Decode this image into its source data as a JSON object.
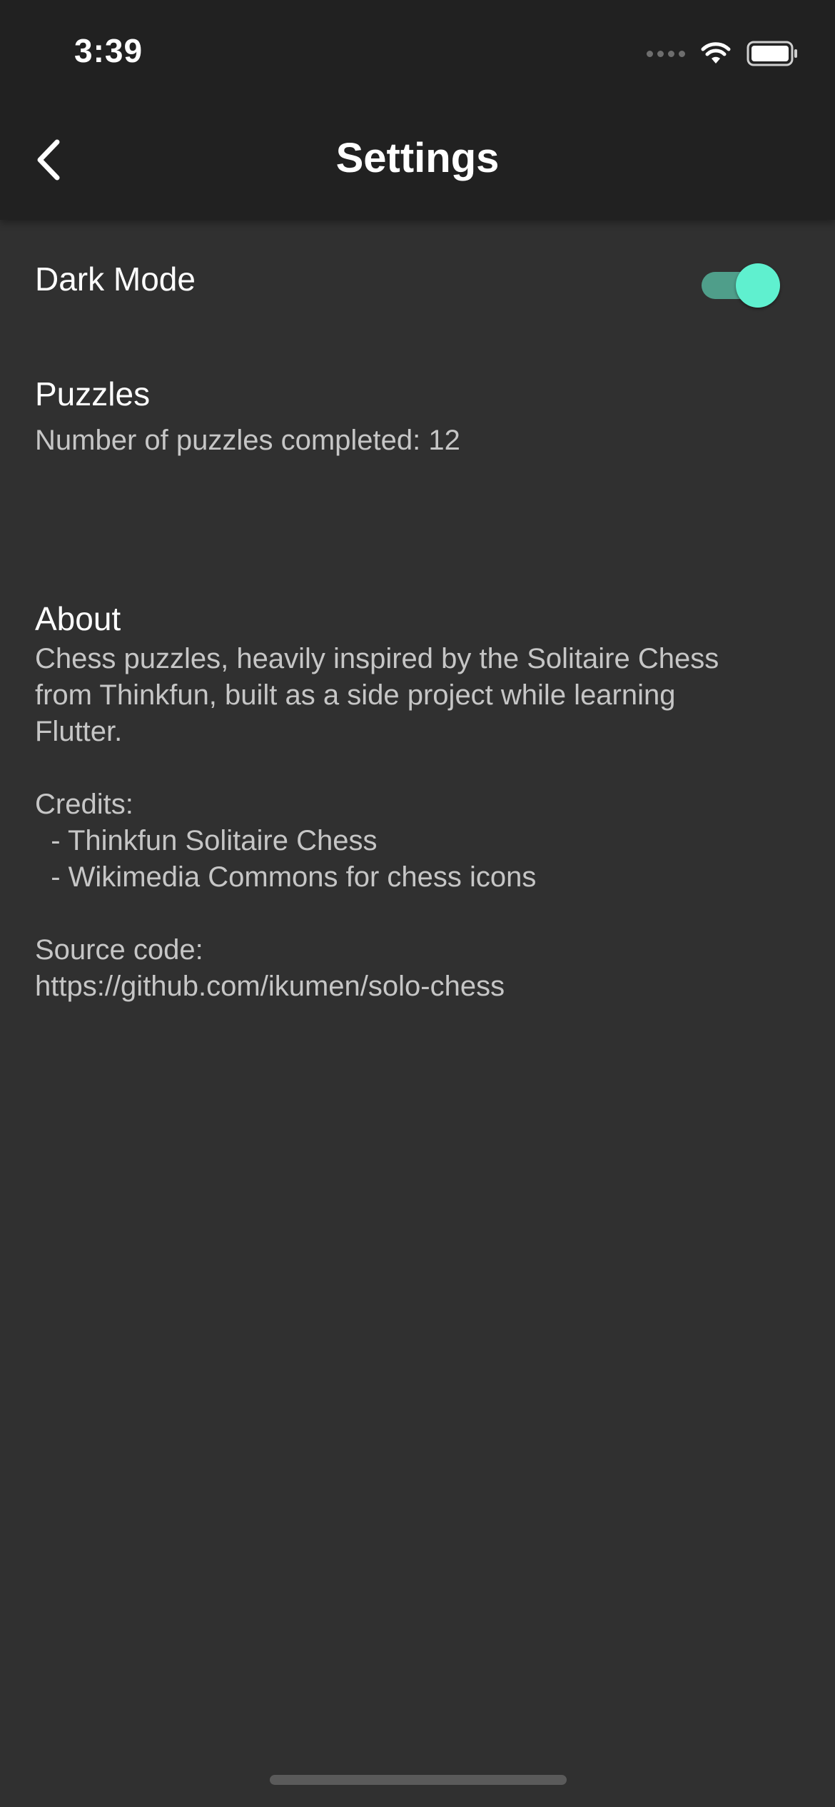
{
  "status_bar": {
    "time": "3:39"
  },
  "header": {
    "title": "Settings",
    "back_icon": "chevron-left-icon"
  },
  "settings": {
    "dark_mode": {
      "label": "Dark Mode",
      "enabled": true
    },
    "puzzles": {
      "title": "Puzzles",
      "completed_text": "Number of puzzles completed: 12"
    },
    "about": {
      "title": "About",
      "lines": [
        "Chess puzzles, heavily inspired by the Solitaire Chess",
        "from Thinkfun, built as a side project while learning",
        "Flutter.",
        "",
        "Credits:",
        "  - Thinkfun Solitaire Chess",
        "  - Wikimedia Commons for chess icons",
        "",
        "Source code:",
        "https://github.com/ikumen/solo-chess"
      ]
    }
  },
  "colors": {
    "background": "#303030",
    "app_bar": "#212121",
    "accent": "#5ff0cf",
    "switch_track": "#4f9e8a"
  }
}
